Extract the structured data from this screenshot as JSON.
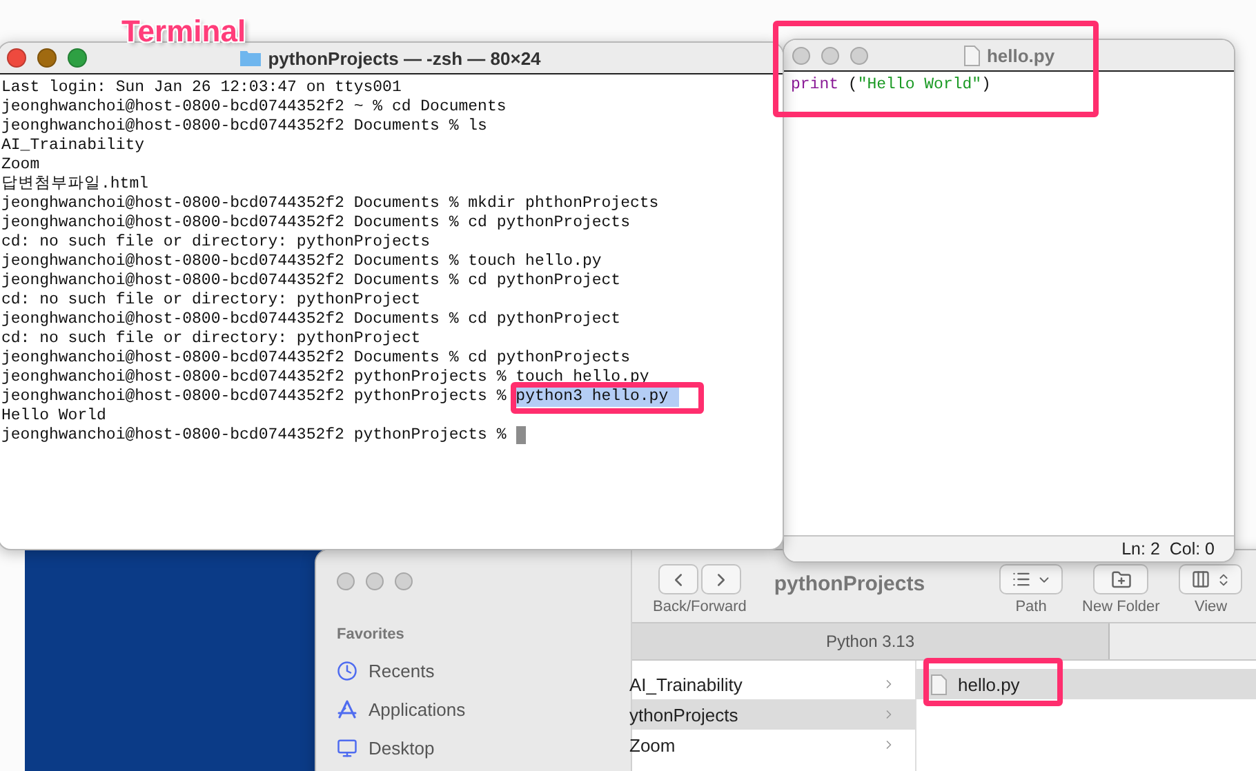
{
  "annotation_label": "Terminal",
  "terminal": {
    "title": "pythonProjects — -zsh — 80×24",
    "lines": [
      {
        "kind": "output",
        "text": "Last login: Sun Jan 26 12:03:47 on ttys001"
      },
      {
        "kind": "output",
        "text": "jeonghwanchoi@host-0800-bcd0744352f2 ~ % cd Documents"
      },
      {
        "kind": "output",
        "text": "jeonghwanchoi@host-0800-bcd0744352f2 Documents % ls"
      },
      {
        "kind": "output",
        "text": "AI_Trainability"
      },
      {
        "kind": "output",
        "text": "Zoom"
      },
      {
        "kind": "output",
        "text": "답변첨부파일.html"
      },
      {
        "kind": "output",
        "text": "jeonghwanchoi@host-0800-bcd0744352f2 Documents % mkdir phthonProjects"
      },
      {
        "kind": "output",
        "text": "jeonghwanchoi@host-0800-bcd0744352f2 Documents % cd pythonProjects"
      },
      {
        "kind": "output",
        "text": "cd: no such file or directory: pythonProjects"
      },
      {
        "kind": "output",
        "text": "jeonghwanchoi@host-0800-bcd0744352f2 Documents % touch hello.py"
      },
      {
        "kind": "output",
        "text": "jeonghwanchoi@host-0800-bcd0744352f2 Documents % cd pythonProject"
      },
      {
        "kind": "output",
        "text": "cd: no such file or directory: pythonProject"
      },
      {
        "kind": "output",
        "text": "jeonghwanchoi@host-0800-bcd0744352f2 Documents % cd pythonProject"
      },
      {
        "kind": "output",
        "text": "cd: no such file or directory: pythonProject"
      },
      {
        "kind": "output",
        "text": "jeonghwanchoi@host-0800-bcd0744352f2 Documents % cd pythonProjects"
      },
      {
        "kind": "output",
        "text": "jeonghwanchoi@host-0800-bcd0744352f2 pythonProjects % touch hello.py"
      },
      {
        "kind": "selected",
        "text": "jeonghwanchoi@host-0800-bcd0744352f2 pythonProjects % ",
        "selection": "python3 hello.py"
      },
      {
        "kind": "output",
        "text": "Hello World"
      },
      {
        "kind": "cursor",
        "text": "jeonghwanchoi@host-0800-bcd0744352f2 pythonProjects % "
      }
    ]
  },
  "editor": {
    "title": "hello.py",
    "code": [
      {
        "kind": "keyword",
        "text": "print"
      },
      {
        "kind": "plain",
        "text": " ("
      },
      {
        "kind": "string",
        "text": "\"Hello World\""
      },
      {
        "kind": "plain",
        "text": ")"
      }
    ],
    "status": "Ln: 2  Col: 0"
  },
  "finder": {
    "title": "pythonProjects",
    "toolbar": [
      {
        "kind": "nav",
        "label": "Back/Forward"
      },
      {
        "kind": "path",
        "label": "Path"
      },
      {
        "kind": "newfolder",
        "label": "New Folder"
      },
      {
        "kind": "view",
        "label": "View"
      }
    ],
    "sidebar_heading": "Favorites",
    "sidebar": [
      {
        "kind": "recents",
        "label": "Recents"
      },
      {
        "kind": "apps",
        "label": "Applications"
      },
      {
        "kind": "desktop",
        "label": "Desktop"
      }
    ],
    "tab": "Python 3.13",
    "column_1": [
      {
        "label": "AI_Trainability",
        "selected": false
      },
      {
        "label": "ythonProjects",
        "selected": true
      },
      {
        "label": "Zoom",
        "selected": false
      }
    ],
    "column_2": [
      {
        "label": "hello.py",
        "selected": true
      }
    ]
  }
}
